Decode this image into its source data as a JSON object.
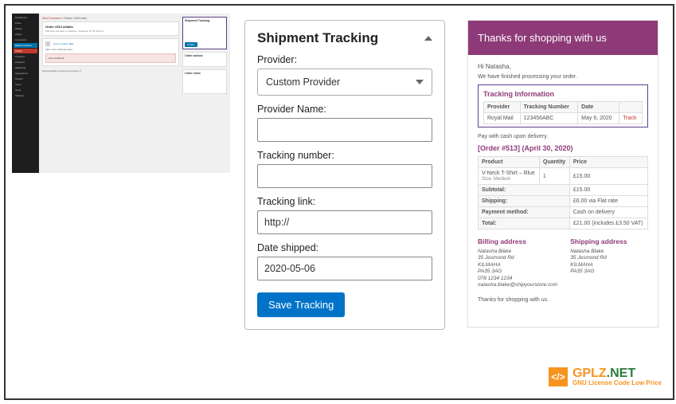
{
  "wp": {
    "crumb_woo": "WooCommerce",
    "crumb_sep": " / Orders / ",
    "crumb_edit": "Edit order",
    "order_title": "Order #513 details",
    "order_sub": "Payment via Cash on delivery. Customer IP: 92.100.0.1",
    "menu": [
      "Dashboard",
      "Posts",
      "Media",
      "Pages",
      "Comments",
      "WooCommerce",
      "Orders",
      "Products",
      "Analytics",
      "Marketing",
      "Appearance",
      "Plugins",
      "Users",
      "Tools",
      "Settings"
    ],
    "panels": {
      "ship_track": "Shipment Tracking",
      "order_actions": "Order actions",
      "order_notes": "Order notes"
    },
    "item_name": "Crew, V-Neck, Blue",
    "item_meta": "SKU: woo-vneck-tee-blue",
    "totals_label": "Items Subtotal:",
    "btn": "Update",
    "footnote": "Downloadable product permissions ▾"
  },
  "form": {
    "title": "Shipment Tracking",
    "provider_label": "Provider:",
    "provider_value": "Custom Provider",
    "provider_name_label": "Provider Name:",
    "tracking_number_label": "Tracking number:",
    "tracking_link_label": "Tracking link:",
    "tracking_link_value": "http://",
    "date_label": "Date shipped:",
    "date_value": "2020-05-06",
    "save": "Save Tracking"
  },
  "email": {
    "banner": "Thanks for shopping with us",
    "greet": "Hi Natasha,",
    "notice": "We have finished processing your order.",
    "track_title": "Tracking Information",
    "track_headers": {
      "provider": "Provider",
      "number": "Tracking Number",
      "date": "Date",
      "link": ""
    },
    "track_row": {
      "provider": "Royal Mail",
      "number": "123456ABC",
      "date": "May 6, 2020",
      "link": "Track"
    },
    "cod": "Pay with cash upon delivery.",
    "order_title": "[Order #513] (April 30, 2020)",
    "order_headers": {
      "product": "Product",
      "qty": "Quantity",
      "price": "Price"
    },
    "order_row": {
      "product": "V-Neck T-Shirt – Blue",
      "size": "Size: Medium",
      "qty": "1",
      "price": "£15.00"
    },
    "summary": {
      "subtotal_l": "Subtotal:",
      "subtotal_v": "£15.00",
      "shipping_l": "Shipping:",
      "shipping_v": "£6.00 via Flat rate",
      "payment_l": "Payment method:",
      "payment_v": "Cash on delivery",
      "total_l": "Total:",
      "total_v": "£21.00 (includes £3.50 VAT)"
    },
    "billing_h": "Billing address",
    "shipping_h": "Shipping address",
    "addr": {
      "name": "Natasha Blake",
      "l1": "35 Jesmond Rd",
      "l2": "KILMAHA",
      "l3": "PA35 3AG",
      "l4": "078 1234 1234",
      "l5": "natasha.blake@shipyourstore.com"
    },
    "addr2": {
      "name": "Natasha Blake",
      "l1": "35 Jesmond Rd",
      "l2": "KILMAHA",
      "l3": "PA35 3AG"
    },
    "thanks": "Thanks for shopping with us."
  },
  "watermark": {
    "brand1": "GPLZ",
    "brand2": ".NET",
    "tag": "GNU License Code Low Price"
  }
}
